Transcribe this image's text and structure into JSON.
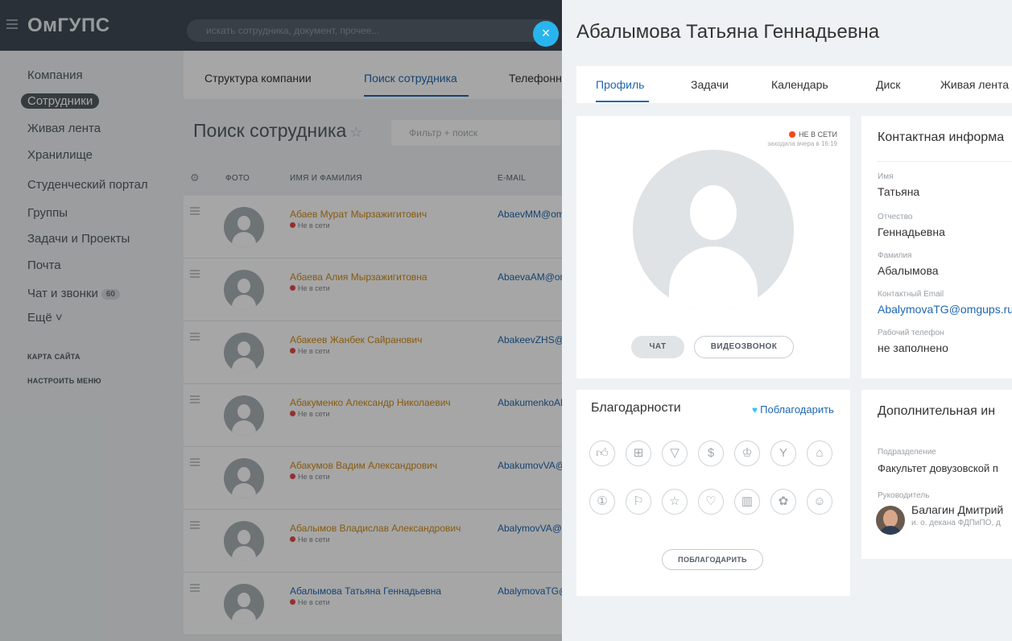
{
  "header": {
    "logo": "ОмГУПС",
    "search_placeholder": "искать сотрудника, документ, прочее...",
    "close_symbol": "×"
  },
  "left_menu": {
    "items": [
      {
        "label": "Компания"
      },
      {
        "label": "Сотрудники",
        "active": true
      },
      {
        "label": "Живая лента"
      },
      {
        "label": "Хранилище"
      },
      {
        "label": "Студенческий портал"
      },
      {
        "label": "Группы"
      },
      {
        "label": "Задачи и Проекты"
      },
      {
        "label": "Почта"
      },
      {
        "label": "Чат и звонки",
        "counter": "60"
      },
      {
        "label": "Ещё ˅"
      }
    ],
    "sitemap": "КАРТА САЙТА",
    "configure": "НАСТРОИТЬ МЕНЮ"
  },
  "content": {
    "tabs": [
      {
        "label": "Структура компании"
      },
      {
        "label": "Поиск сотрудника",
        "active": true
      },
      {
        "label": "Телефонн"
      }
    ],
    "page_title": "Поиск сотрудника",
    "filter_placeholder": "Фильтр + поиск",
    "columns": [
      "ФОТО",
      "ИМЯ И ФАМИЛИЯ",
      "E-MAIL"
    ],
    "rows": [
      {
        "name": "Абаев Мурат Мырзажигитович",
        "status": "Не в сети",
        "email": "AbaevMM@omgups.ru"
      },
      {
        "name": "Абаева Алия Мырзажигитовна",
        "status": "Не в сети",
        "email": "AbaevaAM@omgups.ru"
      },
      {
        "name": "Абакеев Жанбек Сайранович",
        "status": "Не в сети",
        "email": "AbakeevZHS@omgups.ru"
      },
      {
        "name": "Абакуменко Александр Николаевич",
        "status": "Не в сети",
        "email": "AbakumenkoAN@omgups.ru"
      },
      {
        "name": "Абакумов Вадим Александрович",
        "status": "Не в сети",
        "email": "AbakumovVA@omgups.ru"
      },
      {
        "name": "Абалымов Владислав Александрович",
        "status": "Не в сети",
        "email": "AbalymovVA@omgups.ru"
      },
      {
        "name": "Абалымова Татьяна Геннадьевна",
        "status": "Не в сети",
        "email": "AbalymovaTG@omgups.ru"
      }
    ]
  },
  "profile": {
    "title": "Абалымова Татьяна Геннадьевна",
    "tabs": [
      {
        "label": "Профиль",
        "active": true
      },
      {
        "label": "Задачи"
      },
      {
        "label": "Календарь"
      },
      {
        "label": "Диск"
      },
      {
        "label": "Живая лента"
      }
    ],
    "online_status": "НЕ В СЕТИ",
    "last_seen": "заходила вчера в 16:19",
    "chat_button": "ЧАТ",
    "video_button": "ВИДЕОЗВОНОК",
    "thanks": {
      "title": "Благодарности",
      "link": "Поблагодарить",
      "button": "ПОБЛАГОДАРИТЬ",
      "badges": [
        "thumbs-up-icon",
        "gift-icon",
        "cup-icon",
        "money-icon",
        "crown-icon",
        "cocktail-icon",
        "cake-icon",
        "number-one-icon",
        "flag-icon",
        "star-icon",
        "heart-icon",
        "beer-icon",
        "flower-icon",
        "smile-icon"
      ]
    },
    "contact": {
      "title": "Контактная информа",
      "fields": [
        {
          "label": "Имя",
          "value": "Татьяна"
        },
        {
          "label": "Отчество",
          "value": "Геннадьевна"
        },
        {
          "label": "Фамилия",
          "value": "Абалымова"
        },
        {
          "label": "Контактный Email",
          "value": "AbalymovaTG@omgups.ru"
        },
        {
          "label": "Рабочий телефон",
          "value": "не заполнено"
        }
      ]
    },
    "additional": {
      "title": "Дополнительная ин",
      "department_label": "Подразделение",
      "department_value": "Факультет довузовской п",
      "manager_label": "Руководитель",
      "manager_name": "Балагин Дмитрий",
      "manager_position": "и. о. декана ФДПиПО, д"
    }
  },
  "colors": {
    "accent": "#2067b0",
    "offline": "#f54819",
    "close_button": "#28b5ee",
    "topbar": "#3f4b55"
  }
}
